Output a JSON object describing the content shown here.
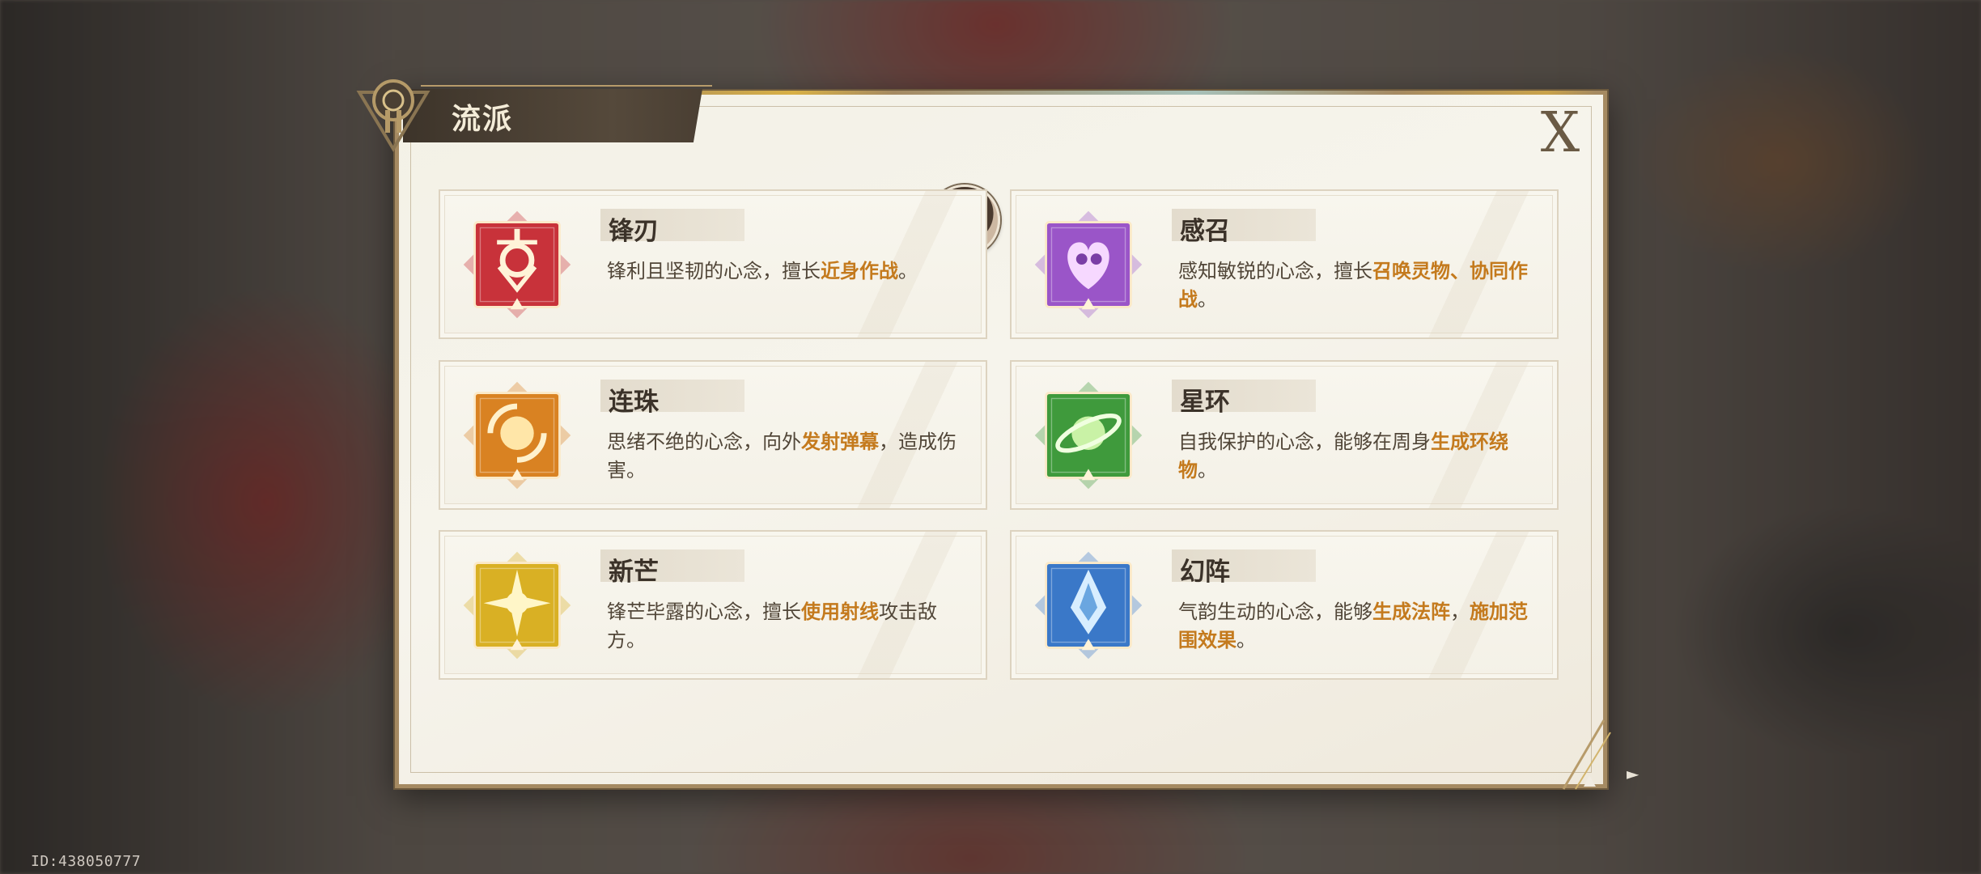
{
  "panel": {
    "title": "流派",
    "close_label": "X"
  },
  "schools": [
    {
      "name": "锋刃",
      "desc_pre": "锋利且坚韧的心念，擅长",
      "desc_hl": "近身作战",
      "desc_post": "。",
      "icon": "blade-icon",
      "color": "#c8323a"
    },
    {
      "name": "感召",
      "desc_pre": "感知敏锐的心念，擅长",
      "desc_hl": "召唤灵物、协同作战",
      "desc_post": "。",
      "icon": "summon-icon",
      "color": "#9a55c8"
    },
    {
      "name": "连珠",
      "desc_pre": "思绪不绝的心念，向外",
      "desc_hl": "发射弹幕",
      "desc_post": "，造成伤害。",
      "icon": "barrage-icon",
      "color": "#d98222"
    },
    {
      "name": "星环",
      "desc_pre": "自我保护的心念，能够在周身",
      "desc_hl": "生成环绕物",
      "desc_post": "。",
      "icon": "orbit-icon",
      "color": "#3f9a3c"
    },
    {
      "name": "新芒",
      "desc_pre": "锋芒毕露的心念，擅长",
      "desc_hl": "使用射线",
      "desc_post": "攻击敌方。",
      "icon": "ray-icon",
      "color": "#d9b024"
    },
    {
      "name": "幻阵",
      "desc_pre": "气韵生动的心念，能够",
      "desc_hl": "生成法阵",
      "desc_mid": "，",
      "desc_hl2": "施加范围效果",
      "desc_post": "。",
      "icon": "array-icon",
      "color": "#3a78c8"
    }
  ],
  "footer": {
    "id_text": "ID:438050777"
  },
  "colors": {
    "accent": "#c47a1d",
    "frame": "#a58a62",
    "panel_bg": "#f5f3ea"
  }
}
